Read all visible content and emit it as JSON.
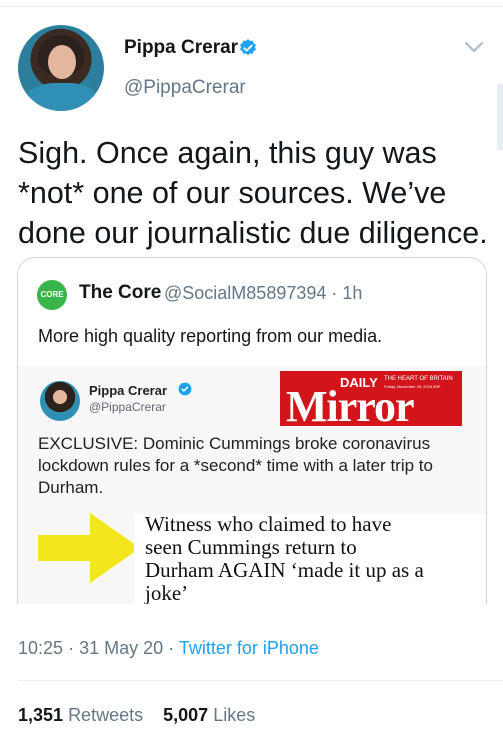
{
  "tweet": {
    "author_name": "Pippa Crerar",
    "author_handle": "@PippaCrerar",
    "text": "Sigh. Once again, this guy was *not* one of our sources. We’ve done our journalistic due diligence.",
    "time": "10:25",
    "date": "31 May 20",
    "separator": "·",
    "app": "Twitter for iPhone",
    "retweets_count": "1,351",
    "retweets_label": "Retweets",
    "likes_count": "5,007",
    "likes_label": "Likes"
  },
  "quoted": {
    "logo_text": "CORE",
    "name": "The Core",
    "handle_time": "@SocialM85897394 · 1h",
    "text": "More high quality reporting from our media."
  },
  "embedded": {
    "name": "Pippa Crerar",
    "handle": "@PippaCrerar",
    "masthead_daily": "DAILY",
    "masthead_word": "Mirror",
    "masthead_tagline": "THE HEART OF BRITAIN",
    "masthead_date": "Friday, November 29, 2019   80P",
    "text": "EXCLUSIVE: Dominic Cummings broke coronavirus lockdown rules for a *second* time with a later trip to Durham.",
    "headline": "Witness who claimed to have\nseen Cummings return to\nDurham AGAIN ‘made it up as a\njoke’"
  },
  "colors": {
    "link": "#1da1f2",
    "verified": "#1da1f2",
    "mirror_red": "#d2151b",
    "arrow": "#f2e61c",
    "core_green": "#39b54a"
  },
  "icons": [
    "verified-badge-icon",
    "chevron-down-icon",
    "arrow-graphic"
  ]
}
